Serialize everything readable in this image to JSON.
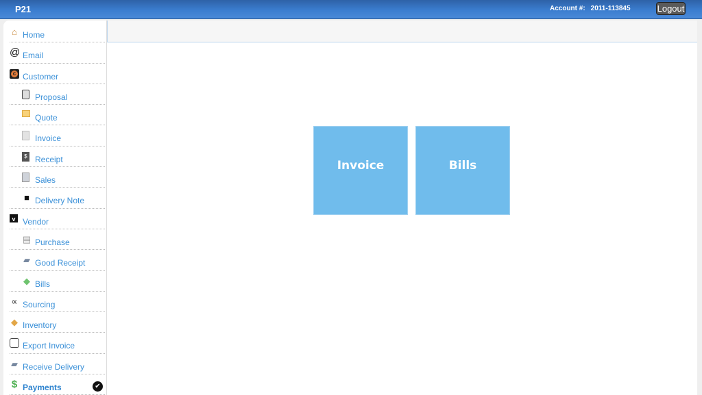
{
  "header": {
    "brand": "P21",
    "account_label": "Account #:",
    "account_number": "2011-113845",
    "logout_label": "Logout"
  },
  "sidebar": {
    "items": [
      {
        "label": "Home",
        "icon": "home-icon",
        "level": 0
      },
      {
        "label": "Email",
        "icon": "at-sign-icon",
        "level": 0
      },
      {
        "label": "Customer",
        "icon": "customer-icon",
        "level": 0
      },
      {
        "label": "Proposal",
        "icon": "proposal-icon",
        "level": 1
      },
      {
        "label": "Quote",
        "icon": "quote-icon",
        "level": 1
      },
      {
        "label": "Invoice",
        "icon": "invoice-icon",
        "level": 1
      },
      {
        "label": "Receipt",
        "icon": "receipt-icon",
        "level": 1
      },
      {
        "label": "Sales",
        "icon": "sales-icon",
        "level": 1
      },
      {
        "label": "Delivery Note",
        "icon": "box-icon",
        "level": 1
      },
      {
        "label": "Vendor",
        "icon": "vendor-icon",
        "level": 0
      },
      {
        "label": "Purchase",
        "icon": "cart-icon",
        "level": 1
      },
      {
        "label": "Good Receipt",
        "icon": "truck-icon",
        "level": 1
      },
      {
        "label": "Bills",
        "icon": "money-icon",
        "level": 1
      },
      {
        "label": "Sourcing",
        "icon": "share-nodes-icon",
        "level": 0
      },
      {
        "label": "Inventory",
        "icon": "package-icon",
        "level": 0
      },
      {
        "label": "Export Invoice",
        "icon": "calendar-icon",
        "level": 0
      },
      {
        "label": "Receive Delivery",
        "icon": "truck-icon",
        "level": 0
      },
      {
        "label": "Payments",
        "icon": "dollar-icon",
        "level": 0,
        "active": true
      }
    ]
  },
  "main": {
    "tiles": [
      {
        "label": "Invoice"
      },
      {
        "label": "Bills"
      }
    ],
    "tile_color": "#70bcec"
  }
}
